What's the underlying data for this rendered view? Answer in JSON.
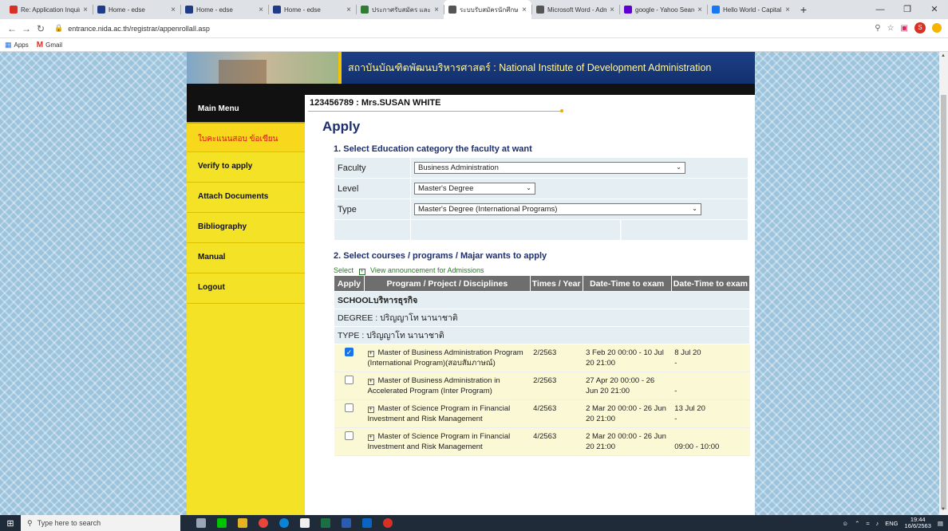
{
  "browser": {
    "tabs": [
      {
        "title": "Re: Application Inquiry",
        "color": "#d93025"
      },
      {
        "title": "Home - edse",
        "color": "#1f3c88"
      },
      {
        "title": "Home - edse",
        "color": "#1f3c88"
      },
      {
        "title": "Home - edse",
        "color": "#1f3c88"
      },
      {
        "title": "ประกาศรับสมัคร และใบสมัค",
        "color": "#2e7d32"
      },
      {
        "title": "ระบบรับสมัครนักศึกษา NII",
        "color": "#555555"
      },
      {
        "title": "Microsoft Word - Admi",
        "color": "#555555"
      },
      {
        "title": "google - Yahoo Search",
        "color": "#6001d2"
      },
      {
        "title": "Hello World - Capital I",
        "color": "#1877f2"
      }
    ],
    "url": "entrance.nida.ac.th/registrar/appenrollall.asp",
    "bookmarks": {
      "apps": "Apps",
      "gmail": "Gmail"
    },
    "avatar_letter": "S"
  },
  "banner": {
    "title": "สถาบันบัณฑิตพัฒนบริหารศาสตร์ : National Institute of Development Administration"
  },
  "sidebar": {
    "header": "Main Menu",
    "items": [
      "ใบคะแนนสอบ ข้อเขียน",
      "Verify to apply",
      "Attach Documents",
      "Bibliography",
      "Manual",
      "Logout"
    ]
  },
  "main": {
    "student": "123456789 : Mrs.SUSAN WHITE",
    "heading": "Apply",
    "section1": "1. Select Education category the faculty at want",
    "faculty_label": "Faculty",
    "faculty_value": "Business Administration",
    "level_label": "Level",
    "level_value": "Master's Degree",
    "type_label": "Type",
    "type_value": "Master's Degree (International Programs)",
    "section2": "2. Select courses / programs / Majar wants to apply",
    "select_prefix": "Select",
    "announcement_link": "View announcement for Admissions",
    "columns": [
      "Apply",
      "Program / Project / Disciplines",
      "Times / Year",
      "Date-Time to exam",
      "Date-Time to exam"
    ],
    "school": "SCHOOLบริหารธุรกิจ",
    "degree": "DEGREE : ปริญญาโท นานาชาติ",
    "type_row": "TYPE : ปริญญาโท นานาชาติ",
    "programs": [
      {
        "checked": true,
        "name": "Master of Business Administration Program (International Program)(สอบสัมภาษณ์)",
        "times": "2/2563",
        "date1": "3 Feb 20 00:00 - 10 Jul 20 21:00",
        "date2a": "8 Jul 20",
        "date2b": "-"
      },
      {
        "checked": false,
        "name": "Master of Business Administration in Accelerated Program (Inter Program)",
        "times": "2/2563",
        "date1": "27 Apr 20 00:00 - 26 Jun 20 21:00",
        "date2a": "",
        "date2b": "-"
      },
      {
        "checked": false,
        "name": "Master of Science Program in Financial Investment and Risk Management",
        "times": "4/2563",
        "date1": "2 Mar 20 00:00 - 26 Jun 20 21:00",
        "date2a": "13 Jul 20",
        "date2b": "-"
      },
      {
        "checked": false,
        "name": "Master of Science Program in Financial Investment and Risk Management",
        "times": "4/2563",
        "date1": "2 Mar 20 00:00 - 26 Jun 20 21:00",
        "date2a": "",
        "date2b": "09:00 - 10:00"
      }
    ]
  },
  "taskbar": {
    "search_placeholder": "Type here to search",
    "lang": "ENG",
    "time": "19:44",
    "date": "16/6/2563"
  }
}
